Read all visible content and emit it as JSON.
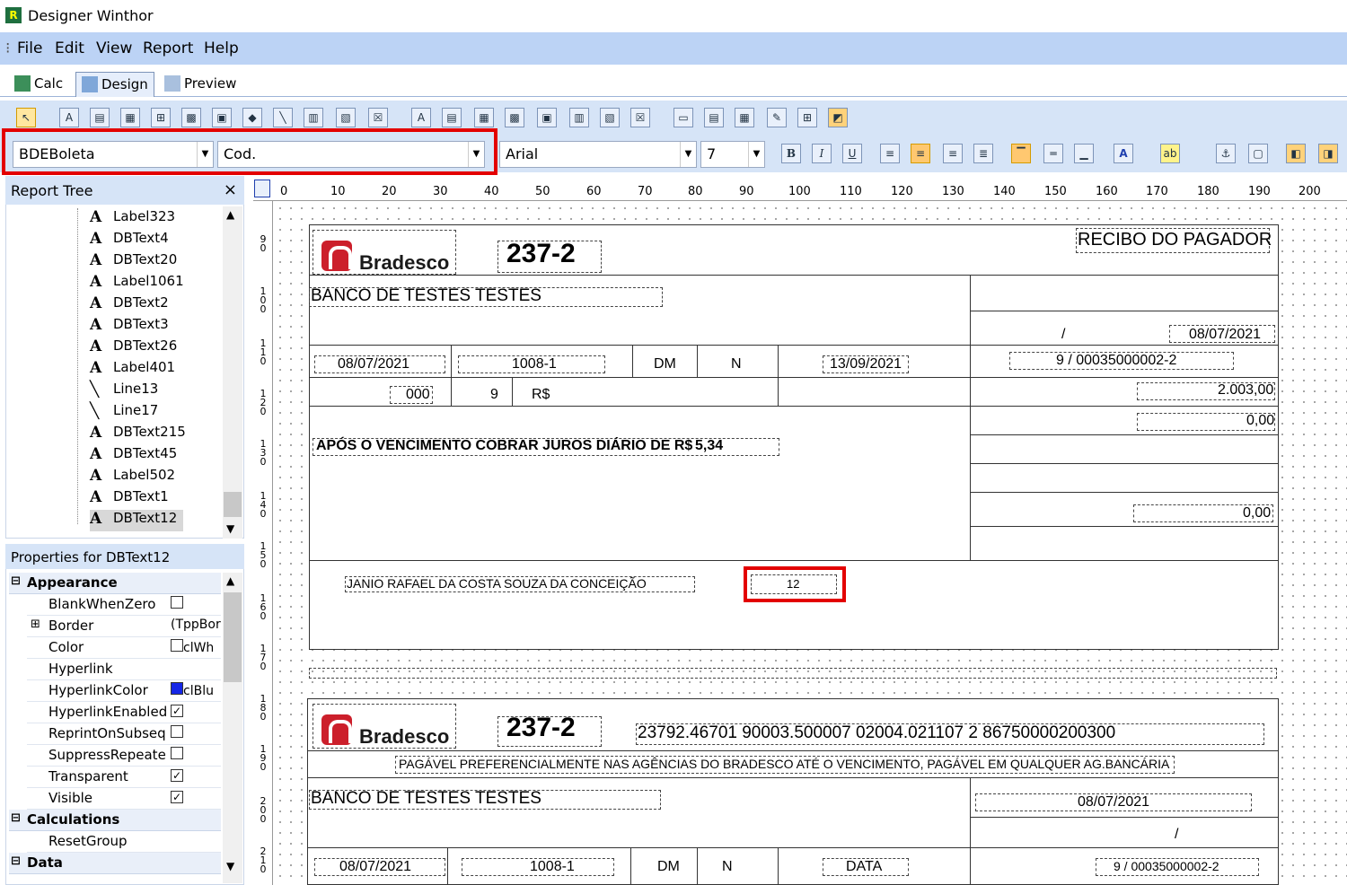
{
  "app": {
    "title": "Designer Winthor",
    "icon": "R"
  },
  "menu": [
    "File",
    "Edit",
    "View",
    "Report",
    "Help"
  ],
  "tabs": [
    {
      "label": "Calc"
    },
    {
      "label": "Design"
    },
    {
      "label": "Preview"
    }
  ],
  "toolbar2": {
    "dataset": "BDEBoleta",
    "field": "Cod.",
    "font": "Arial",
    "size": "7"
  },
  "tree": {
    "title": "Report Tree",
    "close": "×",
    "items": [
      "Label323",
      "DBText4",
      "DBText20",
      "Label1061",
      "DBText2",
      "DBText3",
      "DBText26",
      "Label401",
      "Line13",
      "Line17",
      "DBText215",
      "DBText45",
      "Label502",
      "DBText1",
      "DBText12"
    ]
  },
  "props": {
    "title": "Properties for DBText12",
    "appearance": "Appearance",
    "rows": [
      {
        "name": "BlankWhenZero",
        "value": ""
      },
      {
        "name": "Border",
        "value": "(TppBor"
      },
      {
        "name": "Color",
        "value": "clWh"
      },
      {
        "name": "Hyperlink",
        "value": ""
      },
      {
        "name": "HyperlinkColor",
        "value": "clBlu"
      },
      {
        "name": "HyperlinkEnabled",
        "value": "✓"
      },
      {
        "name": "ReprintOnSubseq",
        "value": ""
      },
      {
        "name": "SuppressRepeate",
        "value": ""
      },
      {
        "name": "Transparent",
        "value": "✓"
      },
      {
        "name": "Visible",
        "value": "✓"
      }
    ],
    "calculations": "Calculations",
    "resetgroup": "ResetGroup",
    "data": "Data"
  },
  "ruler": [
    "0",
    "10",
    "20",
    "30",
    "40",
    "50",
    "60",
    "70",
    "80",
    "90",
    "100",
    "110",
    "120",
    "130",
    "140",
    "150",
    "160",
    "170",
    "180",
    "190",
    "200"
  ],
  "ruler_v": [
    "9 0",
    "1 0 0",
    "1 1 0",
    "1 2 0",
    "1 3 0",
    "1 4 0",
    "1 5 0",
    "1 6 0",
    "1 7 0",
    "1 8 0",
    "1 9 0",
    "2 0 0",
    "2 1 0"
  ],
  "report": {
    "bank_logo": "Bradesco",
    "bank_code": "237-2",
    "recibo": "RECIBO DO PAGADOR",
    "beneficiario": "BANCO DE TESTES TESTES",
    "date1": "08/07/2021",
    "slash": "/",
    "doc_date": "08/07/2021",
    "doc_num": "1008-1",
    "especie": "DM",
    "aceite": "N",
    "proc_date": "13/09/2021",
    "nosso_numero": "9 / 00035000002-2",
    "carteira": "000",
    "cart2": "9",
    "moeda": "R$",
    "valor": "2.003,00",
    "desconto": "0,00",
    "juros_text": "APÓS O VENCIMENTO COBRAR JUROS DIÁRIO DE R$",
    "juros_val": "5,34",
    "acrescimo": "0,00",
    "pagador": "JANIO RAFAEL DA COSTA SOUZA DA CONCEIÇÃO",
    "selected_field": "12",
    "linha_digitavel": "23792.46701  90003.500007  02004.021107  2  86750000200300",
    "local_pagamento": "PAGÁVEL PREFERENCIALMENTE NAS  AGÊNCIAS  DO BRADESCO ATÉ O VENCIMENTO, PAGÁVEL EM QUALQUER AG.BANCÁRIA",
    "beneficiario2": "BANCO DE TESTES TESTES",
    "venc2": "08/07/2021",
    "slash2": "/",
    "doc_date2": "08/07/2021",
    "doc_num2": "1008-1",
    "especie2": "DM",
    "aceite2": "N",
    "data2": "DATA",
    "nosso_numero2": "9 / 00035000002-2"
  }
}
